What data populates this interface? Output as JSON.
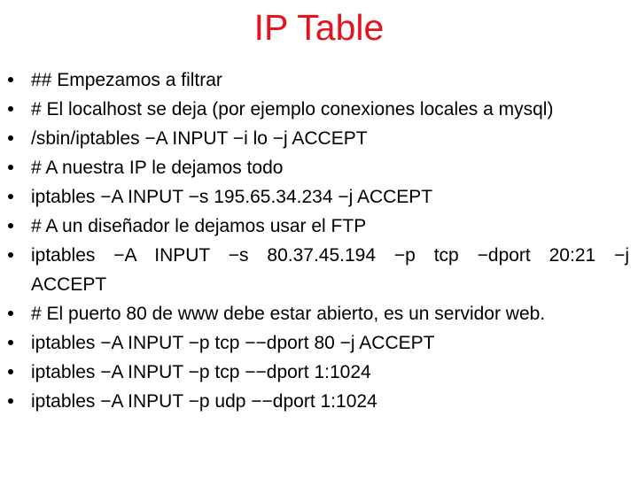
{
  "title": "IP Table",
  "colors": {
    "title": "#e4141e",
    "text": "#000000",
    "background": "#ffffff"
  },
  "bullets": [
    {
      "icon": "bullet-dot-icon",
      "text": "## Empezamos a filtrar"
    },
    {
      "icon": "bullet-dot-icon",
      "text": "# El localhost se deja (por ejemplo conexiones locales a mysql)"
    },
    {
      "icon": "bullet-dot-icon",
      "text": "/sbin/iptables −A INPUT −i lo −j ACCEPT"
    },
    {
      "icon": "bullet-dot-icon",
      "text": "# A nuestra IP le dejamos todo"
    },
    {
      "icon": "bullet-dot-icon",
      "text": "iptables −A INPUT −s 195.65.34.234 −j ACCEPT"
    },
    {
      "icon": "bullet-dot-icon",
      "text": "# A un diseñador le dejamos usar el FTP"
    },
    {
      "icon": "bullet-dot-icon",
      "text": "iptables −A INPUT −s 80.37.45.194 −p tcp −dport 20:21 −j ACCEPT"
    },
    {
      "icon": "bullet-dot-icon",
      "text": "# El puerto 80 de www debe estar abierto, es un servidor web."
    },
    {
      "icon": "bullet-dot-icon",
      "text": "iptables −A INPUT −p tcp −−dport 80 −j ACCEPT"
    },
    {
      "icon": "bullet-dot-icon",
      "text": "iptables −A INPUT −p tcp −−dport 1:1024"
    },
    {
      "icon": "bullet-dot-icon",
      "text": "iptables −A INPUT −p udp −−dport 1:1024"
    }
  ]
}
